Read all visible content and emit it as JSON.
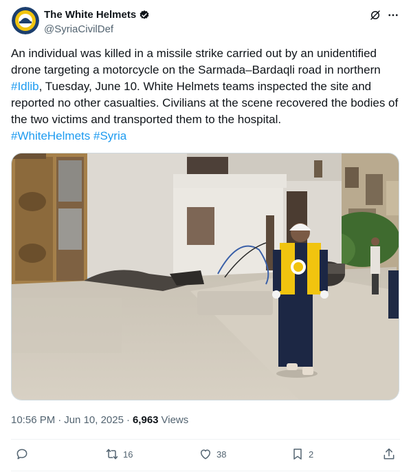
{
  "author": {
    "name": "The White Helmets",
    "handle": "@SyriaCivilDef",
    "verified": true
  },
  "tweet": {
    "text_lead": "An individual was killed in a missile strike carried out by an unidentified drone targeting a motorcycle on the Sarmada–Bardaqli road in northern ",
    "hashtag_1": "#Idlib",
    "text_rest": ", Tuesday, June 10. White Helmets teams inspected the site and reported no other casualties. Civilians at the scene recovered the bodies of the two victims and transported them to the hospital.",
    "hashtag_2": "#WhiteHelmets",
    "hashtag_3": "#Syria"
  },
  "meta": {
    "time": "10:56 PM",
    "separator_1": "·",
    "date": "Jun 10, 2025",
    "separator_2": "·",
    "views_count": "6,963",
    "views_label": "Views"
  },
  "actions": {
    "replies": "",
    "retweets": "16",
    "likes": "38",
    "bookmarks": "2"
  },
  "icons": {
    "grok": "grok-icon",
    "more": "more-icon",
    "verified": "verified-badge-icon",
    "reply": "reply-icon",
    "retweet": "retweet-icon",
    "like": "heart-icon",
    "bookmark": "bookmark-icon",
    "share": "share-icon"
  },
  "colors": {
    "link": "#1d9bf0",
    "muted": "#536471",
    "text": "#0f1419",
    "vest_yellow": "#f1c40f"
  }
}
